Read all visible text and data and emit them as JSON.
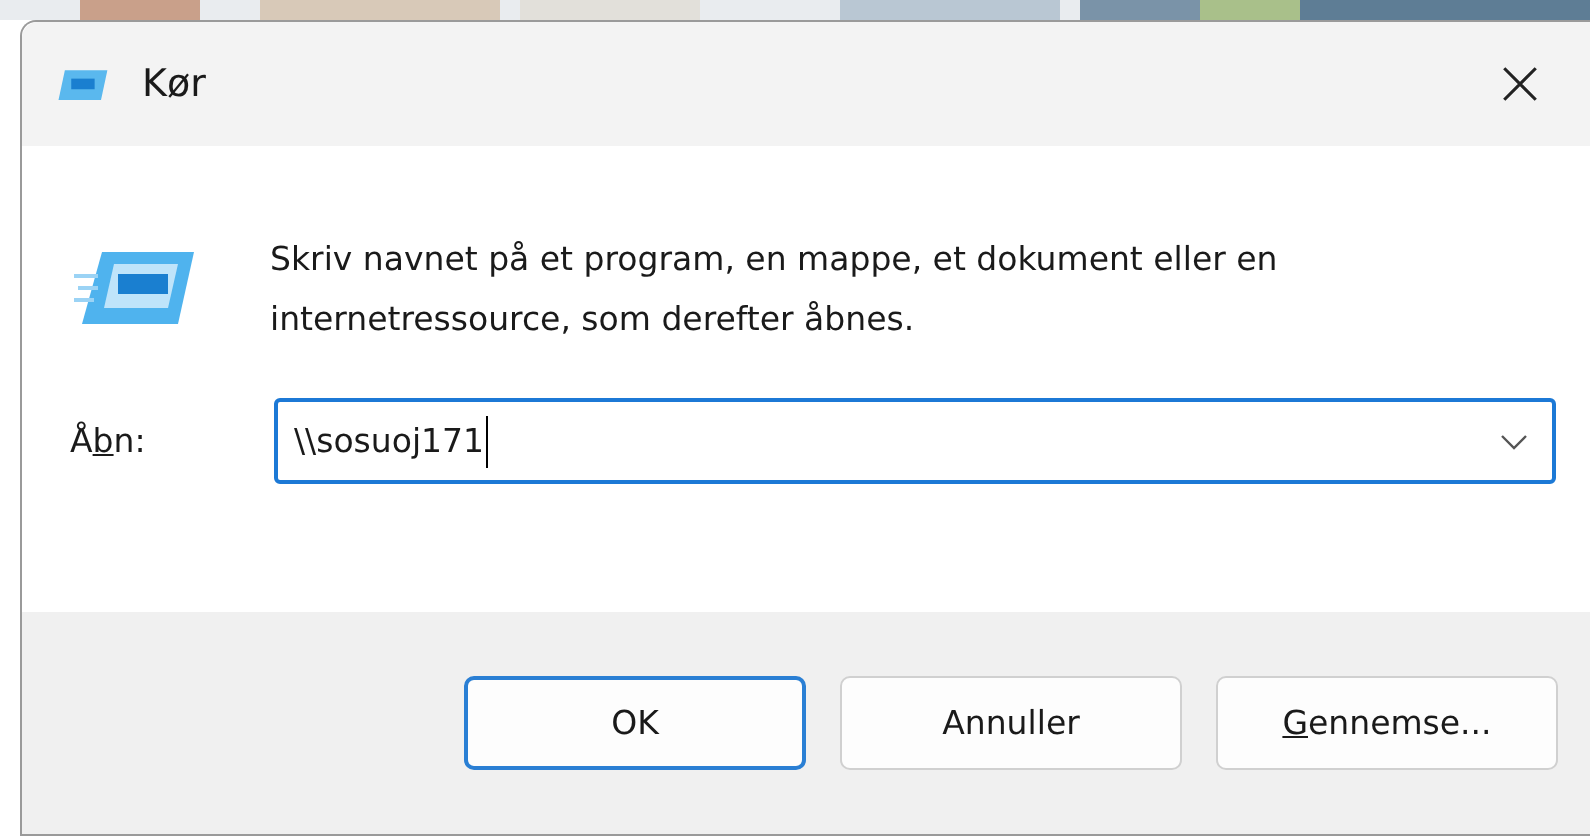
{
  "window": {
    "title": "Kør"
  },
  "description": "Skriv navnet på et program, en mappe, et dokument eller en internetressource, som derefter åbnes.",
  "open_field": {
    "label_before": "Å",
    "label_mnemonic": "b",
    "label_after": "n:",
    "value": "\\\\sosuoj171",
    "focused": true
  },
  "buttons": [
    {
      "label_after": "OK",
      "default": true
    },
    {
      "label_after": "Annuller",
      "default": false
    },
    {
      "label_mnemonic": "G",
      "label_after": "ennemse...",
      "default": false
    }
  ]
}
